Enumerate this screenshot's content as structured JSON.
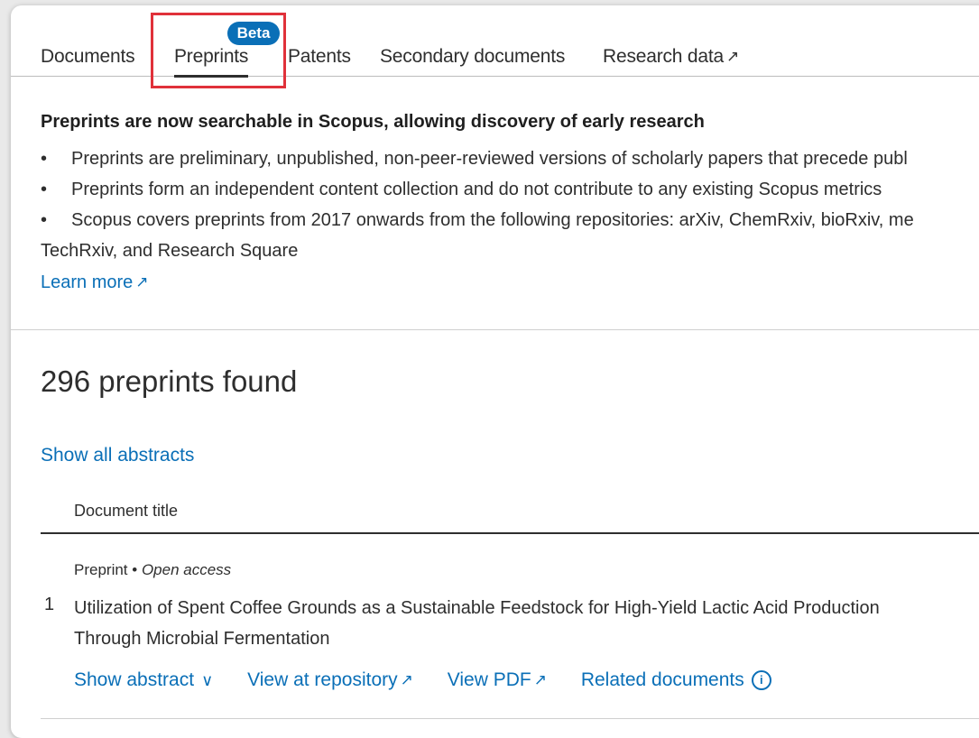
{
  "tabs": [
    {
      "label": "Documents"
    },
    {
      "label": "Preprints",
      "badge": "Beta",
      "active": true
    },
    {
      "label": "Patents"
    },
    {
      "label": "Secondary documents"
    },
    {
      "label": "Research data",
      "external_icon": "↗"
    }
  ],
  "info": {
    "title": "Preprints are now searchable in Scopus, allowing discovery of early research",
    "bullets": [
      "Preprints are preliminary, unpublished, non-peer-reviewed versions of scholarly papers that precede publ",
      "Preprints form an independent content collection and do not contribute to any existing Scopus metrics",
      "Scopus covers preprints from 2017 onwards from the following repositories: arXiv, ChemRxiv, bioRxiv, me"
    ],
    "bullet_continuation": "TechRxiv, and Research Square",
    "learn_more": "Learn more"
  },
  "results": {
    "heading": "296 preprints found",
    "show_all_abstracts": "Show all abstracts",
    "column_header": "Document title",
    "rows": [
      {
        "number": "1",
        "type": "Preprint",
        "separator": "•",
        "access": "Open access",
        "title": "Utilization of Spent Coffee Grounds as a Sustainable Feedstock for High-Yield Lactic Acid Production Through Microbial Fermentation",
        "actions": {
          "show_abstract": "Show abstract",
          "view_repository": "View at repository",
          "view_pdf": "View PDF",
          "related_documents": "Related documents"
        }
      }
    ]
  },
  "icons": {
    "external": "external-link-icon",
    "chevron": "chevron-down-icon",
    "info": "info-icon"
  },
  "colors": {
    "link": "#0a6fb7",
    "badge": "#0a6fb7",
    "highlight": "#e0313a",
    "text": "#2e2e2e"
  }
}
